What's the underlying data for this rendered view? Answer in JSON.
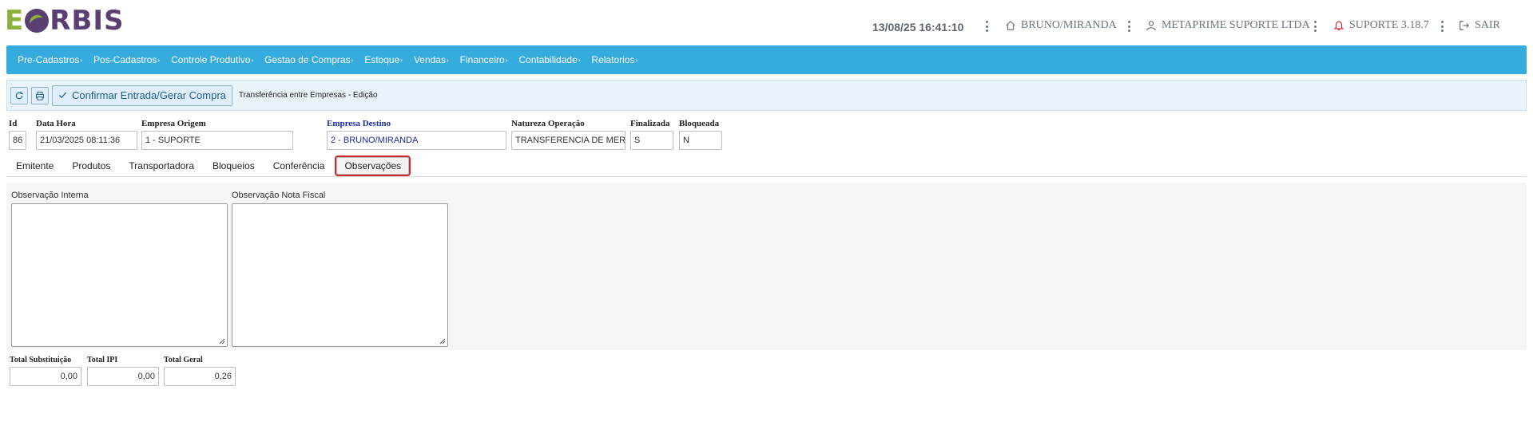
{
  "logo": {
    "e": "E",
    "rest": "RBIS"
  },
  "header": {
    "datetime": "13/08/25 16:41:10",
    "branch": "BRUNO/MIRANDA",
    "company": "METAPRIME SUPORTE LTDA",
    "support": "SUPORTE 3.18.7",
    "logout": "SAIR"
  },
  "menu": [
    "Pre-Cadastros",
    "Pos-Cadastros",
    "Controle Produtivo",
    "Gestao de Compras",
    "Estoque",
    "Vendas",
    "Financeiro",
    "Contabilidade",
    "Relatorios"
  ],
  "toolbar": {
    "confirm_label": "Confirmar Entrada/Gerar Compra",
    "title": "Transferência entre Empresas - Edição"
  },
  "form": {
    "id_label": "Id",
    "id_value": "86",
    "datahora_label": "Data Hora",
    "datahora_value": "21/03/2025 08:11:36",
    "origem_label": "Empresa Origem",
    "origem_value": "1 - SUPORTE",
    "destino_label": "Empresa Destino",
    "destino_value": "2 - BRUNO/MIRANDA",
    "natureza_label": "Natureza Operação",
    "natureza_value": "TRANSFERENCIA DE MERCADORIA",
    "finalizada_label": "Finalizada",
    "finalizada_value": "S",
    "bloqueada_label": "Bloqueada",
    "bloqueada_value": "N"
  },
  "tabs": [
    "Emitente",
    "Produtos",
    "Transportadora",
    "Bloqueios",
    "Conferência",
    "Observações"
  ],
  "active_tab": "Observações",
  "observacoes": {
    "interna_label": "Observação Interna",
    "interna_value": "",
    "nota_label": "Observação Nota Fiscal",
    "nota_value": ""
  },
  "totals": {
    "substituicao_label": "Total Substituição",
    "substituicao_value": "0,00",
    "ipi_label": "Total IPI",
    "ipi_value": "0,00",
    "geral_label": "Total Geral",
    "geral_value": "0,26"
  },
  "colors": {
    "menubar": "#35acdd",
    "active_tab_border": "#d0282c",
    "logo_green": "#8bb03c",
    "logo_purple": "#5a3f73",
    "support_icon": "#d0282c"
  },
  "icons": {
    "refresh": "refresh-icon",
    "print": "print-icon",
    "check": "check-icon",
    "home": "home-icon",
    "user": "user-icon",
    "bell": "bell-icon",
    "logout": "logout-icon"
  }
}
